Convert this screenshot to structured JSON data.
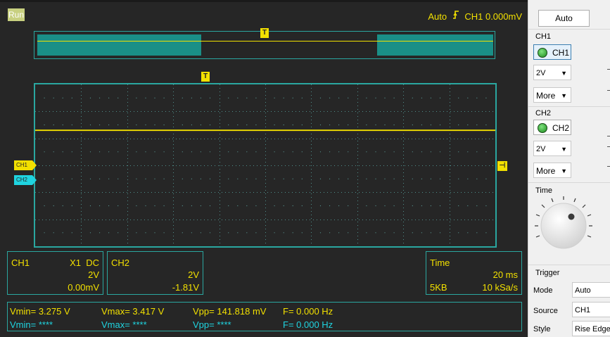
{
  "status": {
    "run": "Run",
    "trigger_mode": "Auto",
    "trigger_edge_icon": "rising-edge-icon",
    "trigger_source_level": "CH1 0.000mV"
  },
  "markers": {
    "trigger": "T"
  },
  "channels": {
    "ch1_tag": "CH1",
    "ch2_tag": "CH2"
  },
  "ch1_box": {
    "name": "CH1",
    "probe_coupling": "X1  DC",
    "volts_div": "2V",
    "offset": "0.00mV"
  },
  "ch2_box": {
    "name": "CH2",
    "volts_div": "2V",
    "offset": "-1.81V"
  },
  "time_box": {
    "name": "Time",
    "time_div": "20 ms",
    "memory": "5KB",
    "sample_rate": "10 kSa/s"
  },
  "measurements": {
    "ch1": {
      "vmin": "Vmin= 3.275 V",
      "vmax": "Vmax= 3.417 V",
      "vpp": "Vpp= 141.818 mV",
      "freq": "F= 0.000 Hz"
    },
    "ch2": {
      "vmin": "Vmin= ****",
      "vmax": "Vmax= ****",
      "vpp": "Vpp= ****",
      "freq": "F= 0.000 Hz"
    }
  },
  "panel": {
    "auto_button": "Auto",
    "ch1_label": "CH1",
    "ch1_button": "CH1",
    "ch1_volts": "2V",
    "ch1_more": "More",
    "ch2_label": "CH2",
    "ch2_button": "CH2",
    "ch2_volts": "2V",
    "ch2_more": "More",
    "time_label": "Time",
    "trigger_label": "Trigger",
    "mode_label": "Mode",
    "mode_value": "Auto",
    "source_label": "Source",
    "source_value": "CH1",
    "style_label": "Style",
    "style_value": "Rise Edge"
  },
  "colors": {
    "ch1": "#f2e000",
    "ch2": "#1fd4e0",
    "frame": "#2aa7a0",
    "background": "#262626"
  },
  "display": {
    "overview_view_start": 0.36,
    "overview_view_end": 0.745,
    "ch1_trace_level_div": 1.7
  }
}
